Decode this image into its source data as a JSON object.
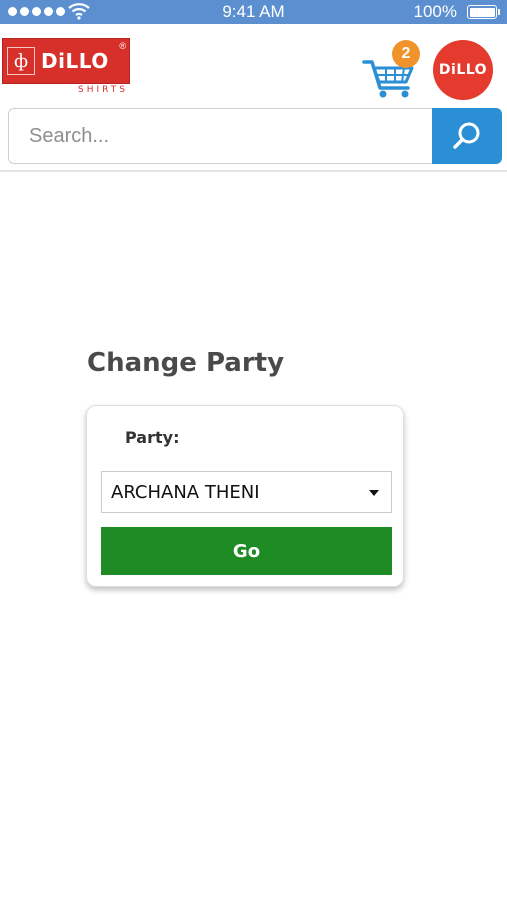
{
  "status_bar": {
    "time": "9:41 AM",
    "battery": "100%",
    "signal_icon": "signal-dots-icon",
    "wifi_icon": "wifi-icon",
    "battery_icon": "battery-icon"
  },
  "header": {
    "logo": {
      "brand": "DiLLO",
      "registered": "®",
      "subtitle": "SHIRTS"
    },
    "cart": {
      "icon": "cart-icon",
      "count": "2"
    },
    "avatar": {
      "text": "DiLLO"
    },
    "search": {
      "placeholder": "Search...",
      "value": "",
      "icon": "search-icon"
    }
  },
  "main": {
    "title": "Change Party",
    "form": {
      "party_label": "Party:",
      "party_value": "ARCHANA THENI",
      "go_label": "Go"
    }
  },
  "colors": {
    "status_bar": "#5b8fd0",
    "brand_red": "#d7302b",
    "badge_orange": "#f0932b",
    "search_blue": "#2b8fd6",
    "go_green": "#1f8b24",
    "title_gray": "#4a4a4a"
  }
}
